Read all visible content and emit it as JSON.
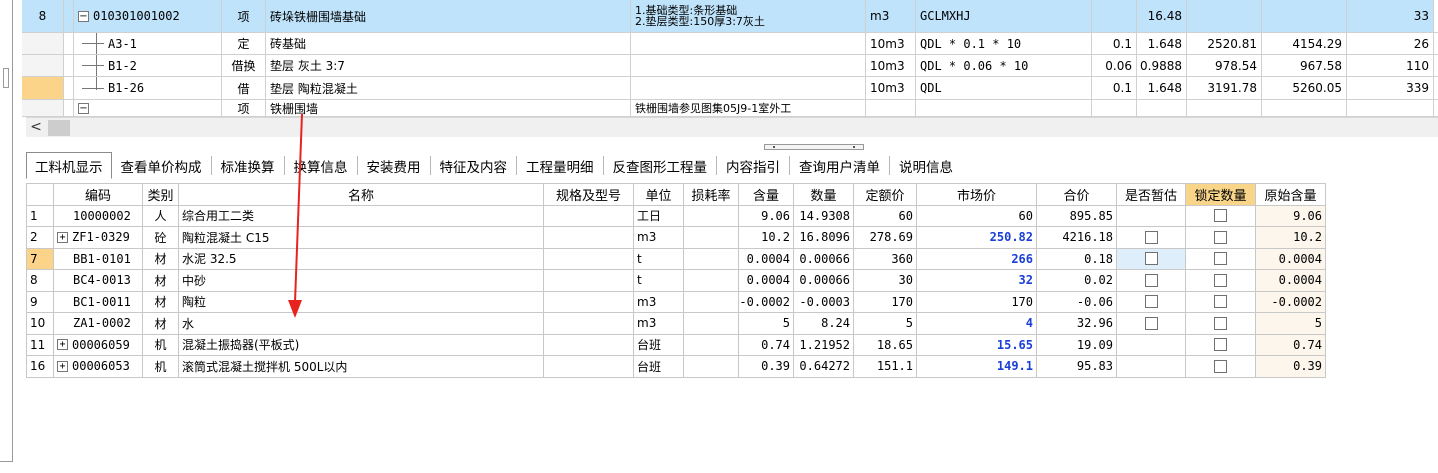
{
  "top_grid": {
    "rows": [
      {
        "num": "8",
        "code": "010301001002",
        "type": "项",
        "name": "砖垛铁栅围墙基础",
        "spec_line1": "1.基础类型:条形基础",
        "spec_line2": "2.垫层类型:150厚3:7灰土",
        "unit": "m3",
        "formula": "GCLMXHJ",
        "coef": "",
        "qty": "16.48",
        "price": "",
        "total": "",
        "extra": "33",
        "selected": true,
        "expand": "minus"
      },
      {
        "num": "",
        "code": "A3-1",
        "type": "定",
        "name": "砖基础",
        "spec_line1": "",
        "spec_line2": "",
        "unit": "10m3",
        "formula": "QDL * 0.1 * 10",
        "coef": "0.1",
        "qty": "1.648",
        "price": "2520.81",
        "total": "4154.29",
        "extra": "26"
      },
      {
        "num": "",
        "code": "B1-2",
        "type": "借换",
        "name": "垫层 灰土 3:7",
        "spec_line1": "",
        "spec_line2": "",
        "unit": "10m3",
        "formula": "QDL * 0.06 * 10",
        "coef": "0.06",
        "qty": "0.9888",
        "price": "978.54",
        "total": "967.58",
        "extra": "110"
      },
      {
        "num": "",
        "code": "B1-26",
        "type": "借",
        "name": "垫层 陶粒混凝土",
        "spec_line1": "",
        "spec_line2": "",
        "unit": "10m3",
        "formula": "QDL",
        "coef": "0.1",
        "qty": "1.648",
        "price": "3191.78",
        "total": "5260.05",
        "extra": "339",
        "current": true
      },
      {
        "num": "",
        "code": "",
        "type": "项",
        "name": "铁栅围墙",
        "spec_line1": "铁栅围墙参见图集05J9-1室外工",
        "spec_line2": "",
        "unit": "",
        "formula": "",
        "coef": "",
        "qty": "",
        "price": "",
        "total": "",
        "extra": "",
        "partial": true
      }
    ]
  },
  "scrollbar": {
    "left_arrow": "<"
  },
  "tabs": [
    {
      "label": "工料机显示",
      "active": true
    },
    {
      "label": "查看单价构成"
    },
    {
      "label": "标准换算"
    },
    {
      "label": "换算信息"
    },
    {
      "label": "安装费用"
    },
    {
      "label": "特征及内容"
    },
    {
      "label": "工程量明细"
    },
    {
      "label": "反查图形工程量"
    },
    {
      "label": "内容指引"
    },
    {
      "label": "查询用户清单"
    },
    {
      "label": "说明信息"
    }
  ],
  "bottom_grid": {
    "headers": {
      "idx": "",
      "code": "编码",
      "category": "类别",
      "name": "名称",
      "spec": "规格及型号",
      "unit": "单位",
      "loss": "损耗率",
      "content": "含量",
      "qty": "数量",
      "quota_price": "定额价",
      "market_price": "市场价",
      "total": "合价",
      "provisional": "是否暂估",
      "lock_qty": "锁定数量",
      "orig_content": "原始含量"
    },
    "rows": [
      {
        "idx": "1",
        "expand": "",
        "code": "10000002",
        "category": "人",
        "name": "综合用工二类",
        "spec": "",
        "unit": "工日",
        "loss": "",
        "content": "9.06",
        "qty": "14.9308",
        "quota_price": "60",
        "market_price": "60",
        "market_blue": false,
        "total": "895.85",
        "provisional_chk": false,
        "lock_chk": true,
        "orig_content": "9.06"
      },
      {
        "idx": "2",
        "expand": "+",
        "code": "ZF1-0329",
        "category": "砼",
        "name": "陶粒混凝土 C15",
        "spec": "",
        "unit": "m3",
        "loss": "",
        "content": "10.2",
        "qty": "16.8096",
        "quota_price": "278.69",
        "market_price": "250.82",
        "market_blue": true,
        "total": "4216.18",
        "provisional_chk": true,
        "lock_chk": true,
        "orig_content": "10.2"
      },
      {
        "idx": "7",
        "expand": "",
        "code": "BB1-0101",
        "category": "材",
        "name": "水泥 32.5",
        "spec": "",
        "unit": "t",
        "loss": "",
        "content": "0.0004",
        "qty": "0.00066",
        "quota_price": "360",
        "market_price": "266",
        "market_blue": true,
        "total": "0.18",
        "provisional_chk": true,
        "lock_chk": true,
        "orig_content": "0.0004",
        "highlight": true
      },
      {
        "idx": "8",
        "expand": "",
        "code": "BC4-0013",
        "category": "材",
        "name": "中砂",
        "spec": "",
        "unit": "t",
        "loss": "",
        "content": "0.0004",
        "qty": "0.00066",
        "quota_price": "30",
        "market_price": "32",
        "market_blue": true,
        "total": "0.02",
        "provisional_chk": true,
        "lock_chk": true,
        "orig_content": "0.0004"
      },
      {
        "idx": "9",
        "expand": "",
        "code": "BC1-0011",
        "category": "材",
        "name": "陶粒",
        "spec": "",
        "unit": "m3",
        "loss": "",
        "content": "-0.0002",
        "qty": "-0.0003",
        "quota_price": "170",
        "market_price": "170",
        "market_blue": false,
        "total": "-0.06",
        "provisional_chk": true,
        "lock_chk": true,
        "orig_content": "-0.0002"
      },
      {
        "idx": "10",
        "expand": "",
        "code": "ZA1-0002",
        "category": "材",
        "name": "水",
        "spec": "",
        "unit": "m3",
        "loss": "",
        "content": "5",
        "qty": "8.24",
        "quota_price": "5",
        "market_price": "4",
        "market_blue": true,
        "total": "32.96",
        "provisional_chk": true,
        "lock_chk": true,
        "orig_content": "5"
      },
      {
        "idx": "11",
        "expand": "+",
        "code": "00006059",
        "category": "机",
        "name": "混凝土振捣器(平板式)",
        "spec": "",
        "unit": "台班",
        "loss": "",
        "content": "0.74",
        "qty": "1.21952",
        "quota_price": "18.65",
        "market_price": "15.65",
        "market_blue": true,
        "total": "19.09",
        "provisional_chk": false,
        "lock_chk": true,
        "orig_content": "0.74"
      },
      {
        "idx": "16",
        "expand": "+",
        "code": "00006053",
        "category": "机",
        "name": "滚筒式混凝土搅拌机 500L以内",
        "spec": "",
        "unit": "台班",
        "loss": "",
        "content": "0.39",
        "qty": "0.64272",
        "quota_price": "151.1",
        "market_price": "149.1",
        "market_blue": true,
        "total": "95.83",
        "provisional_chk": false,
        "lock_chk": true,
        "orig_content": "0.39"
      }
    ]
  },
  "annotation": {
    "arrow_color": "#e8231f"
  }
}
